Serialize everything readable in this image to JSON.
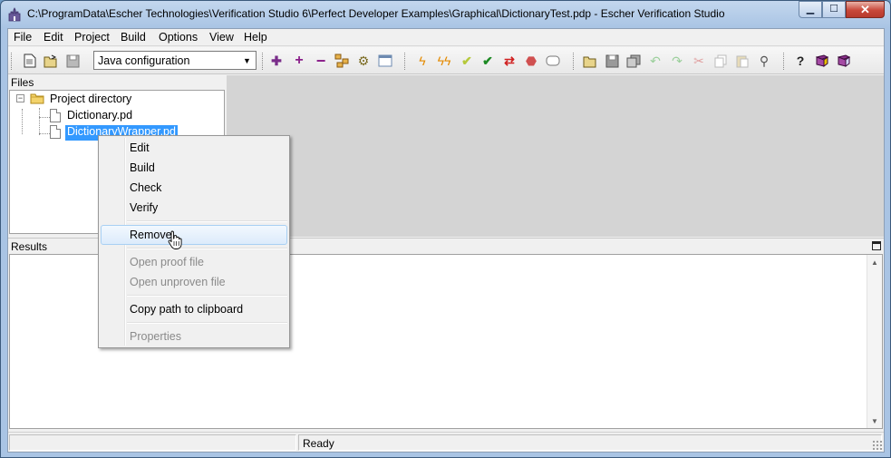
{
  "window": {
    "title": "C:\\ProgramData\\Escher Technologies\\Verification Studio 6\\Perfect Developer Examples\\Graphical\\DictionaryTest.pdp - Escher Verification Studio",
    "icon": "castle-app-icon"
  },
  "menu": [
    "File",
    "Edit",
    "Project",
    "Build",
    "Options",
    "View",
    "Help"
  ],
  "toolbar": {
    "configuration": "Java configuration",
    "icons": [
      "new-file-icon",
      "open-icon",
      "save-icon",
      "new-item-icon",
      "add-icon",
      "remove-icon",
      "dependencies-icon",
      "settings-icon",
      "window-icon",
      "build-icon",
      "rebuild-icon",
      "check-icon",
      "verify-icon",
      "refresh-icon",
      "stop-icon",
      "blank-icon",
      "open-folder-icon",
      "save-all-icon",
      "copy-pages-icon",
      "undo-icon",
      "redo-icon",
      "cut-icon",
      "copy-icon",
      "paste-icon",
      "find-icon",
      "help-icon",
      "book-icon",
      "book-2-icon"
    ]
  },
  "files_panel": {
    "title": "Files",
    "root": "Project directory",
    "items": [
      "Dictionary.pd",
      "DictionaryWrapper.pd"
    ]
  },
  "results_panel": {
    "title": "Results"
  },
  "status": {
    "text": "Ready"
  },
  "context_menu": {
    "items": [
      {
        "label": "Edit",
        "enabled": true
      },
      {
        "label": "Build",
        "enabled": true
      },
      {
        "label": "Check",
        "enabled": true
      },
      {
        "label": "Verify",
        "enabled": true
      },
      {
        "label": "Remove",
        "enabled": true,
        "highlighted": true
      },
      {
        "label": "Open proof file",
        "enabled": false
      },
      {
        "label": "Open unproven file",
        "enabled": false
      },
      {
        "label": "Copy path to clipboard",
        "enabled": true
      },
      {
        "label": "Properties",
        "enabled": false
      }
    ]
  },
  "colors": {
    "selection": "#3399ff",
    "title_bar": "#a9c4e4",
    "hover": "#dcebfb"
  }
}
